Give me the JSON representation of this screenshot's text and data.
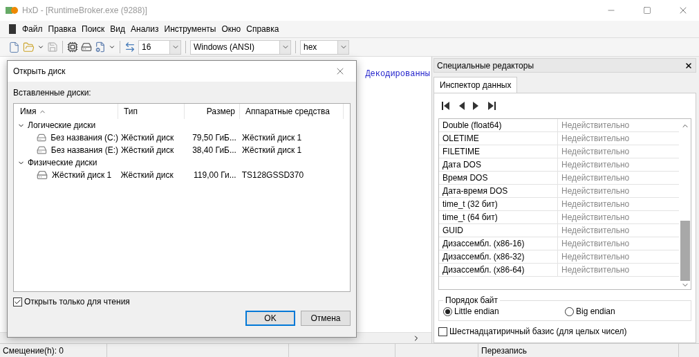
{
  "window": {
    "title": "HxD - [RuntimeBroker.exe (9288)]"
  },
  "menu": [
    "Файл",
    "Правка",
    "Поиск",
    "Вид",
    "Анализ",
    "Инструменты",
    "Окно",
    "Справка"
  ],
  "toolbar": {
    "bytes_per_row": "16",
    "charset": "Windows (ANSI)",
    "offset_base": "hex"
  },
  "editor": {
    "column_header": "Декодированны"
  },
  "side_panel": {
    "title": "Специальные редакторы",
    "tabs": [
      {
        "label": "Инспектор данных",
        "selected": true
      }
    ],
    "rows": [
      {
        "name": "Double (float64)",
        "value": "Недействительно"
      },
      {
        "name": "OLETIME",
        "value": "Недействительно"
      },
      {
        "name": "FILETIME",
        "value": "Недействительно"
      },
      {
        "name": "Дата DOS",
        "value": "Недействительно"
      },
      {
        "name": "Время DOS",
        "value": "Недействительно"
      },
      {
        "name": "Дата-время DOS",
        "value": "Недействительно"
      },
      {
        "name": "time_t (32 бит)",
        "value": "Недействительно"
      },
      {
        "name": "time_t (64 бит)",
        "value": "Недействительно"
      },
      {
        "name": "GUID",
        "value": "Недействительно"
      },
      {
        "name": "Дизассембл. (x86-16)",
        "value": "Недействительно"
      },
      {
        "name": "Дизассембл. (x86-32)",
        "value": "Недействительно"
      },
      {
        "name": "Дизассембл. (x86-64)",
        "value": "Недействительно"
      }
    ],
    "byte_order": {
      "title": "Порядок байт",
      "options": [
        {
          "label": "Little endian",
          "selected": true
        },
        {
          "label": "Big endian",
          "selected": false
        }
      ]
    },
    "hex_base": {
      "label": "Шестнадцатиричный базис (для целых чисел)",
      "checked": false
    }
  },
  "status_bar": [
    "Смещение(h): 0",
    "Перезапись"
  ],
  "dialog": {
    "title": "Открыть диск",
    "list_label": "Вставленные диски:",
    "columns": [
      {
        "label": "Имя",
        "sorted": true
      },
      {
        "label": "Тип",
        "sorted": false
      },
      {
        "label": "Размер",
        "sorted": false
      },
      {
        "label": "Аппаратные средства",
        "sorted": false
      }
    ],
    "groups": [
      {
        "label": "Логические диски",
        "expanded": true,
        "children": [
          {
            "name": "Без названия (C:)",
            "type": "Жёсткий диск",
            "size": "79,50 ГиБ...",
            "hardware": "Жёсткий диск 1"
          },
          {
            "name": "Без названия (E:)",
            "type": "Жёсткий диск",
            "size": "38,40 ГиБ...",
            "hardware": "Жёсткий диск 1"
          }
        ]
      },
      {
        "label": "Физические диски",
        "expanded": true,
        "children": [
          {
            "name": "Жёсткий диск 1",
            "type": "Жёсткий диск",
            "size": "119,00 Ги...",
            "hardware": "TS128GSSD370"
          }
        ]
      }
    ],
    "read_only": {
      "label": "Открыть только для чтения",
      "checked": true
    },
    "buttons": [
      {
        "label": "OK",
        "default": true
      },
      {
        "label": "Отмена",
        "default": false
      }
    ]
  }
}
